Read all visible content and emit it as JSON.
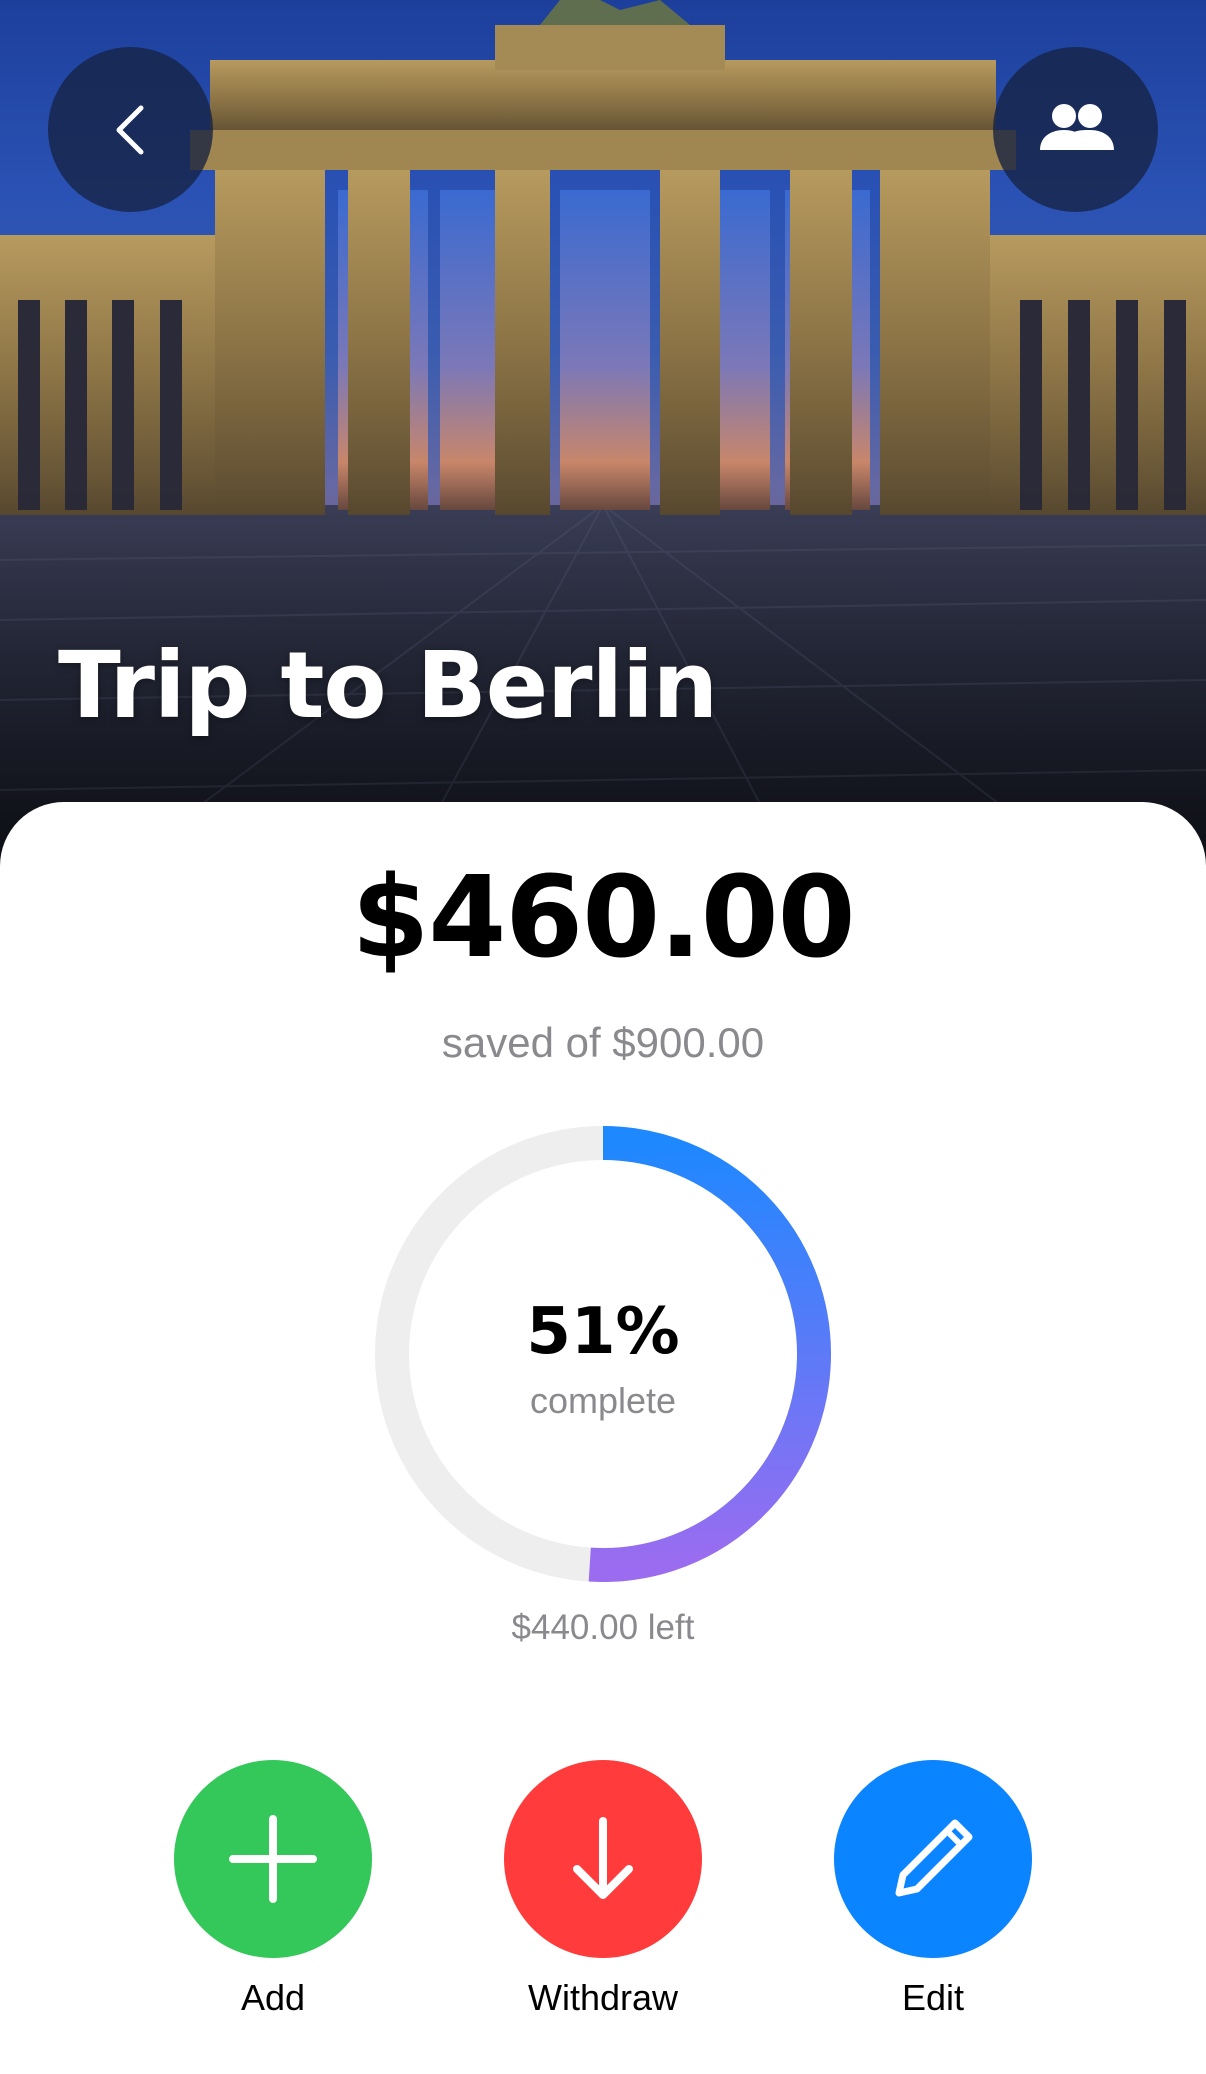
{
  "hero": {
    "title": "Trip to Berlin",
    "back_icon": "chevron-left-icon",
    "members_icon": "people-icon"
  },
  "goal": {
    "saved_amount": "$460.00",
    "saved_of_text": "saved of $900.00",
    "progress_fraction": 0.51,
    "percent_text": "51%",
    "complete_label": "complete",
    "left_text": "$440.00 left"
  },
  "colors": {
    "ring_track": "#eeeeee",
    "ring_start": "#1e88ff",
    "ring_end": "#9b6cf0",
    "add": "#34c759",
    "withdraw": "#ff3b3b",
    "edit": "#0a84ff"
  },
  "actions": [
    {
      "label": "Add",
      "icon": "plus-icon"
    },
    {
      "label": "Withdraw",
      "icon": "arrow-down-icon"
    },
    {
      "label": "Edit",
      "icon": "pencil-icon"
    }
  ]
}
